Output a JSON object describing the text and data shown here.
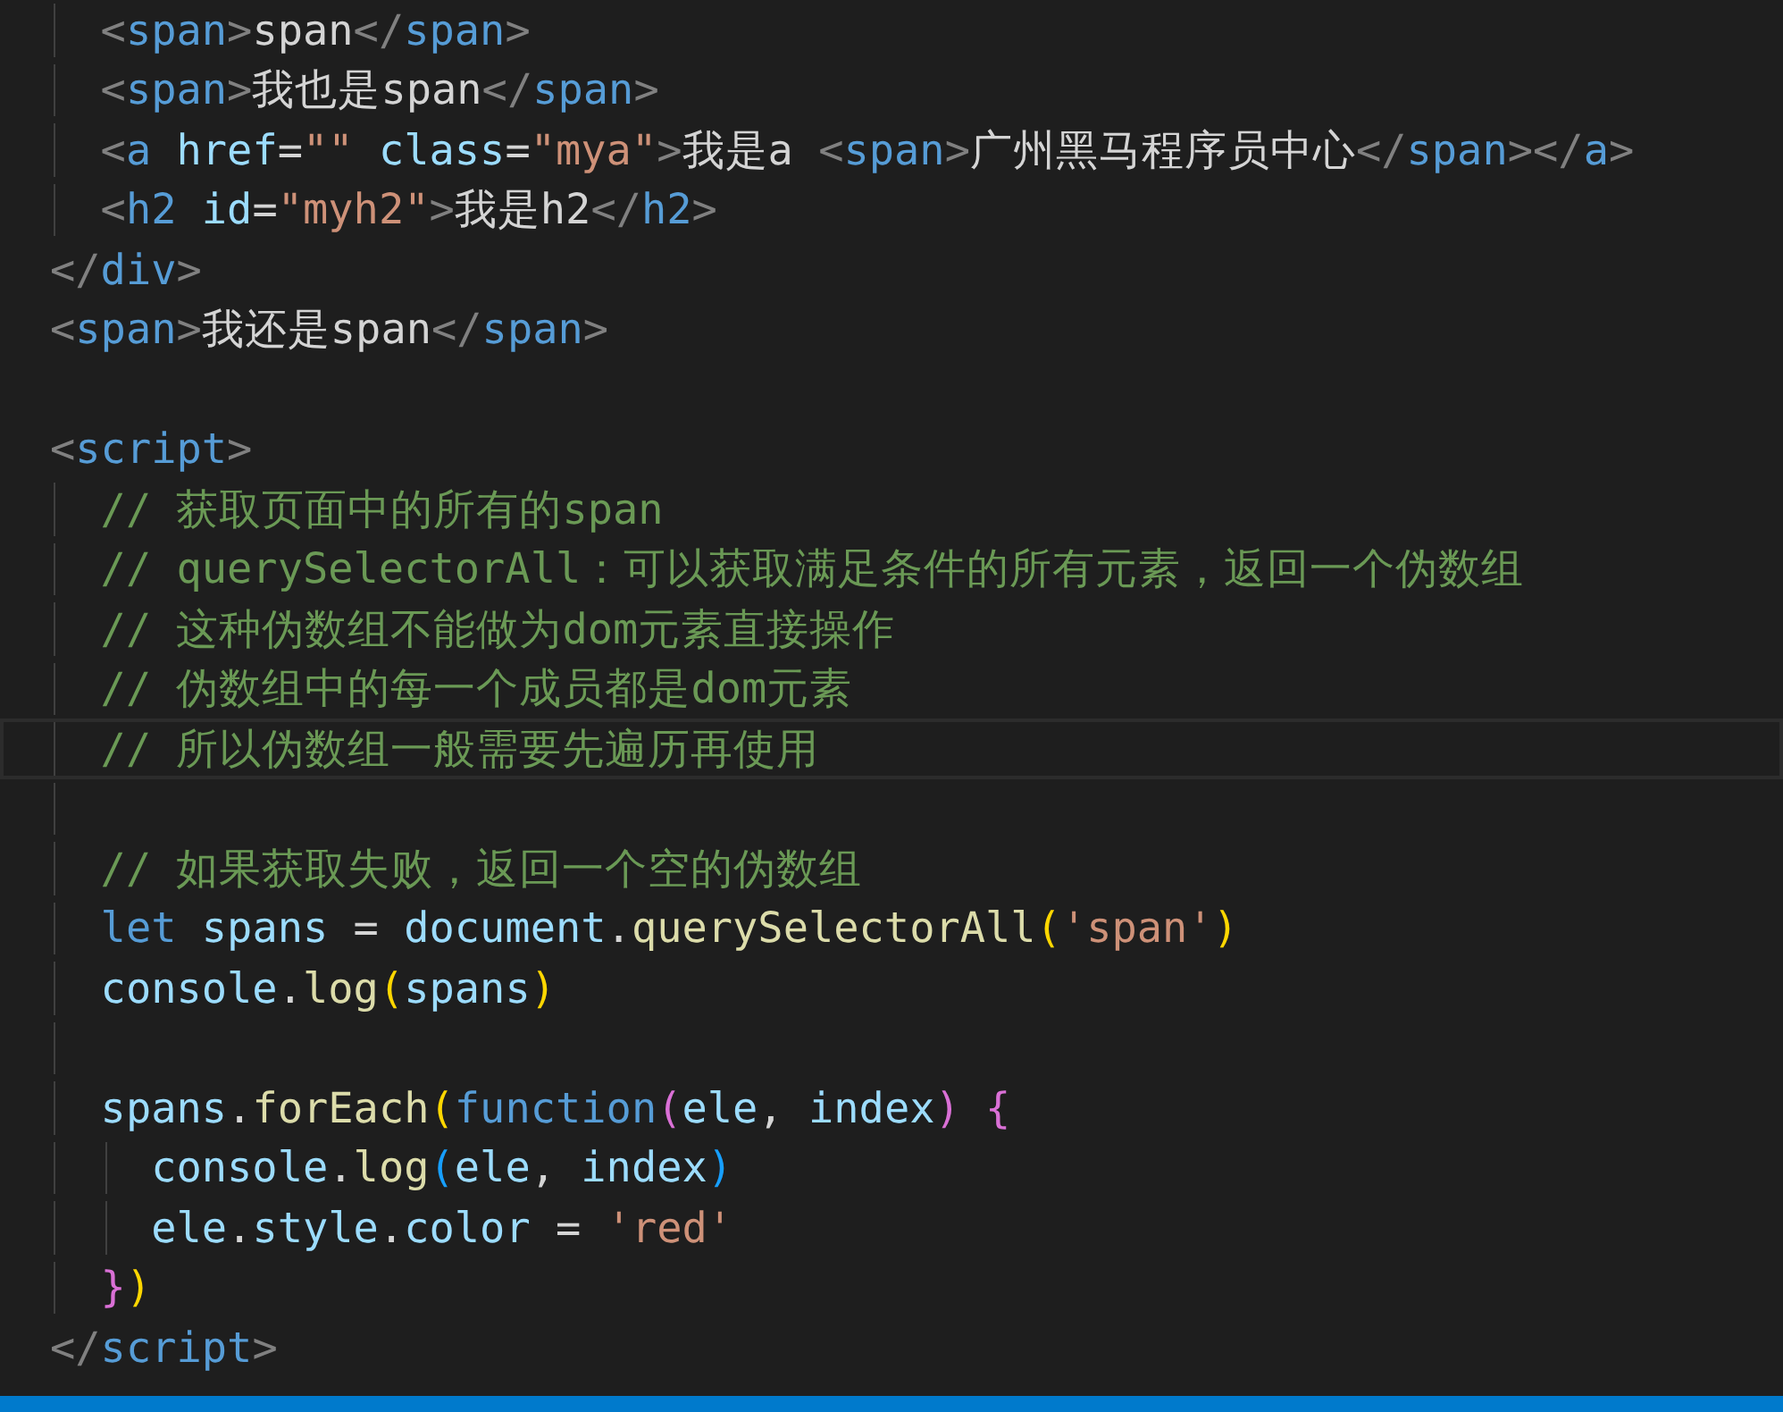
{
  "editor": {
    "lines": [
      {
        "current": false,
        "tokens": [
          {
            "kind": "punct",
            "text": "  <"
          },
          {
            "kind": "tag",
            "text": "span"
          },
          {
            "kind": "punct",
            "text": ">"
          },
          {
            "kind": "plain",
            "text": "span"
          },
          {
            "kind": "punct",
            "text": "</"
          },
          {
            "kind": "tag",
            "text": "span"
          },
          {
            "kind": "punct",
            "text": ">"
          }
        ]
      },
      {
        "current": false,
        "tokens": [
          {
            "kind": "punct",
            "text": "  <"
          },
          {
            "kind": "tag",
            "text": "span"
          },
          {
            "kind": "punct",
            "text": ">"
          },
          {
            "kind": "plain",
            "text": "我也是span"
          },
          {
            "kind": "punct",
            "text": "</"
          },
          {
            "kind": "tag",
            "text": "span"
          },
          {
            "kind": "punct",
            "text": ">"
          }
        ]
      },
      {
        "current": false,
        "tokens": [
          {
            "kind": "punct",
            "text": "  <"
          },
          {
            "kind": "tag",
            "text": "a"
          },
          {
            "kind": "attr",
            "text": " href"
          },
          {
            "kind": "plain",
            "text": "="
          },
          {
            "kind": "string",
            "text": "\"\""
          },
          {
            "kind": "attr",
            "text": " class"
          },
          {
            "kind": "plain",
            "text": "="
          },
          {
            "kind": "string",
            "text": "\"mya\""
          },
          {
            "kind": "punct",
            "text": ">"
          },
          {
            "kind": "plain",
            "text": "我是a "
          },
          {
            "kind": "punct",
            "text": "<"
          },
          {
            "kind": "tag",
            "text": "span"
          },
          {
            "kind": "punct",
            "text": ">"
          },
          {
            "kind": "plain",
            "text": "广州黑马程序员中心"
          },
          {
            "kind": "punct",
            "text": "</"
          },
          {
            "kind": "tag",
            "text": "span"
          },
          {
            "kind": "punct",
            "text": "></"
          },
          {
            "kind": "tag",
            "text": "a"
          },
          {
            "kind": "punct",
            "text": ">"
          }
        ]
      },
      {
        "current": false,
        "tokens": [
          {
            "kind": "punct",
            "text": "  <"
          },
          {
            "kind": "tag",
            "text": "h2"
          },
          {
            "kind": "attr",
            "text": " id"
          },
          {
            "kind": "plain",
            "text": "="
          },
          {
            "kind": "string",
            "text": "\"myh2\""
          },
          {
            "kind": "punct",
            "text": ">"
          },
          {
            "kind": "plain",
            "text": "我是h2"
          },
          {
            "kind": "punct",
            "text": "</"
          },
          {
            "kind": "tag",
            "text": "h2"
          },
          {
            "kind": "punct",
            "text": ">"
          }
        ]
      },
      {
        "current": false,
        "tokens": [
          {
            "kind": "punct",
            "text": "</"
          },
          {
            "kind": "tag",
            "text": "div"
          },
          {
            "kind": "punct",
            "text": ">"
          }
        ]
      },
      {
        "current": false,
        "tokens": [
          {
            "kind": "punct",
            "text": "<"
          },
          {
            "kind": "tag",
            "text": "span"
          },
          {
            "kind": "punct",
            "text": ">"
          },
          {
            "kind": "plain",
            "text": "我还是span"
          },
          {
            "kind": "punct",
            "text": "</"
          },
          {
            "kind": "tag",
            "text": "span"
          },
          {
            "kind": "punct",
            "text": ">"
          }
        ]
      },
      {
        "current": false
      },
      {
        "current": false,
        "tokens": [
          {
            "kind": "punct",
            "text": "<"
          },
          {
            "kind": "tag",
            "text": "script"
          },
          {
            "kind": "punct",
            "text": ">"
          }
        ]
      },
      {
        "current": false,
        "tokens": [
          {
            "kind": "comment",
            "text": "  // 获取页面中的所有的span"
          }
        ]
      },
      {
        "current": false,
        "tokens": [
          {
            "kind": "comment",
            "text": "  // querySelectorAll：可以获取满足条件的所有元素，返回一个伪数组"
          }
        ]
      },
      {
        "current": false,
        "tokens": [
          {
            "kind": "comment",
            "text": "  // 这种伪数组不能做为dom元素直接操作"
          }
        ]
      },
      {
        "current": false,
        "tokens": [
          {
            "kind": "comment",
            "text": "  // 伪数组中的每一个成员都是dom元素"
          }
        ]
      },
      {
        "current": true,
        "tokens": [
          {
            "kind": "comment",
            "text": "  // 所以伪数组一般需要先遍历再使用"
          }
        ]
      },
      {
        "current": false
      },
      {
        "current": false,
        "tokens": [
          {
            "kind": "comment",
            "text": "  // 如果获取失败，返回一个空的伪数组"
          }
        ]
      },
      {
        "current": false,
        "tokens": [
          {
            "kind": "keyword",
            "text": "  let"
          },
          {
            "kind": "variable",
            "text": " spans"
          },
          {
            "kind": "plain",
            "text": " = "
          },
          {
            "kind": "variable",
            "text": "document"
          },
          {
            "kind": "plain",
            "text": "."
          },
          {
            "kind": "function",
            "text": "querySelectorAll"
          },
          {
            "kind": "bracket1",
            "text": "("
          },
          {
            "kind": "string",
            "text": "'span'"
          },
          {
            "kind": "bracket1",
            "text": ")"
          }
        ]
      },
      {
        "current": false,
        "tokens": [
          {
            "kind": "variable",
            "text": "  console"
          },
          {
            "kind": "plain",
            "text": "."
          },
          {
            "kind": "function",
            "text": "log"
          },
          {
            "kind": "bracket1",
            "text": "("
          },
          {
            "kind": "variable",
            "text": "spans"
          },
          {
            "kind": "bracket1",
            "text": ")"
          }
        ]
      },
      {
        "current": false
      },
      {
        "current": false,
        "tokens": [
          {
            "kind": "variable",
            "text": "  spans"
          },
          {
            "kind": "plain",
            "text": "."
          },
          {
            "kind": "function",
            "text": "forEach"
          },
          {
            "kind": "bracket1",
            "text": "("
          },
          {
            "kind": "keyword",
            "text": "function"
          },
          {
            "kind": "bracket2",
            "text": "("
          },
          {
            "kind": "variable",
            "text": "ele"
          },
          {
            "kind": "plain",
            "text": ", "
          },
          {
            "kind": "variable",
            "text": "index"
          },
          {
            "kind": "bracket2",
            "text": ")"
          },
          {
            "kind": "bracket2",
            "text": " {"
          }
        ]
      },
      {
        "current": false,
        "tokens": [
          {
            "kind": "variable",
            "text": "    console"
          },
          {
            "kind": "plain",
            "text": "."
          },
          {
            "kind": "function",
            "text": "log"
          },
          {
            "kind": "bracket3",
            "text": "("
          },
          {
            "kind": "variable",
            "text": "ele"
          },
          {
            "kind": "plain",
            "text": ", "
          },
          {
            "kind": "variable",
            "text": "index"
          },
          {
            "kind": "bracket3",
            "text": ")"
          }
        ]
      },
      {
        "current": false,
        "tokens": [
          {
            "kind": "variable",
            "text": "    ele"
          },
          {
            "kind": "plain",
            "text": "."
          },
          {
            "kind": "variable",
            "text": "style"
          },
          {
            "kind": "plain",
            "text": "."
          },
          {
            "kind": "variable",
            "text": "color"
          },
          {
            "kind": "plain",
            "text": " = "
          },
          {
            "kind": "string",
            "text": "'red'"
          }
        ]
      },
      {
        "current": false,
        "tokens": [
          {
            "kind": "bracket2",
            "text": "  }"
          },
          {
            "kind": "bracket1",
            "text": ")"
          }
        ]
      },
      {
        "current": false,
        "tokens": [
          {
            "kind": "punct",
            "text": "</"
          },
          {
            "kind": "tag",
            "text": "script"
          },
          {
            "kind": "punct",
            "text": ">"
          }
        ]
      }
    ]
  }
}
